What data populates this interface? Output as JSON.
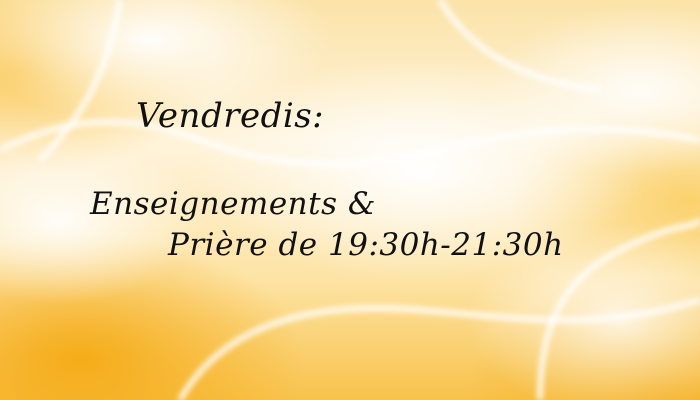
{
  "lines": {
    "day": "Vendredis:",
    "activity": "Enseignements &",
    "schedule": "Prière de 19:30h-21:30h"
  },
  "colors": {
    "background_light": "#fff4dc",
    "background_gold": "#f8c24a",
    "text": "#111111"
  }
}
